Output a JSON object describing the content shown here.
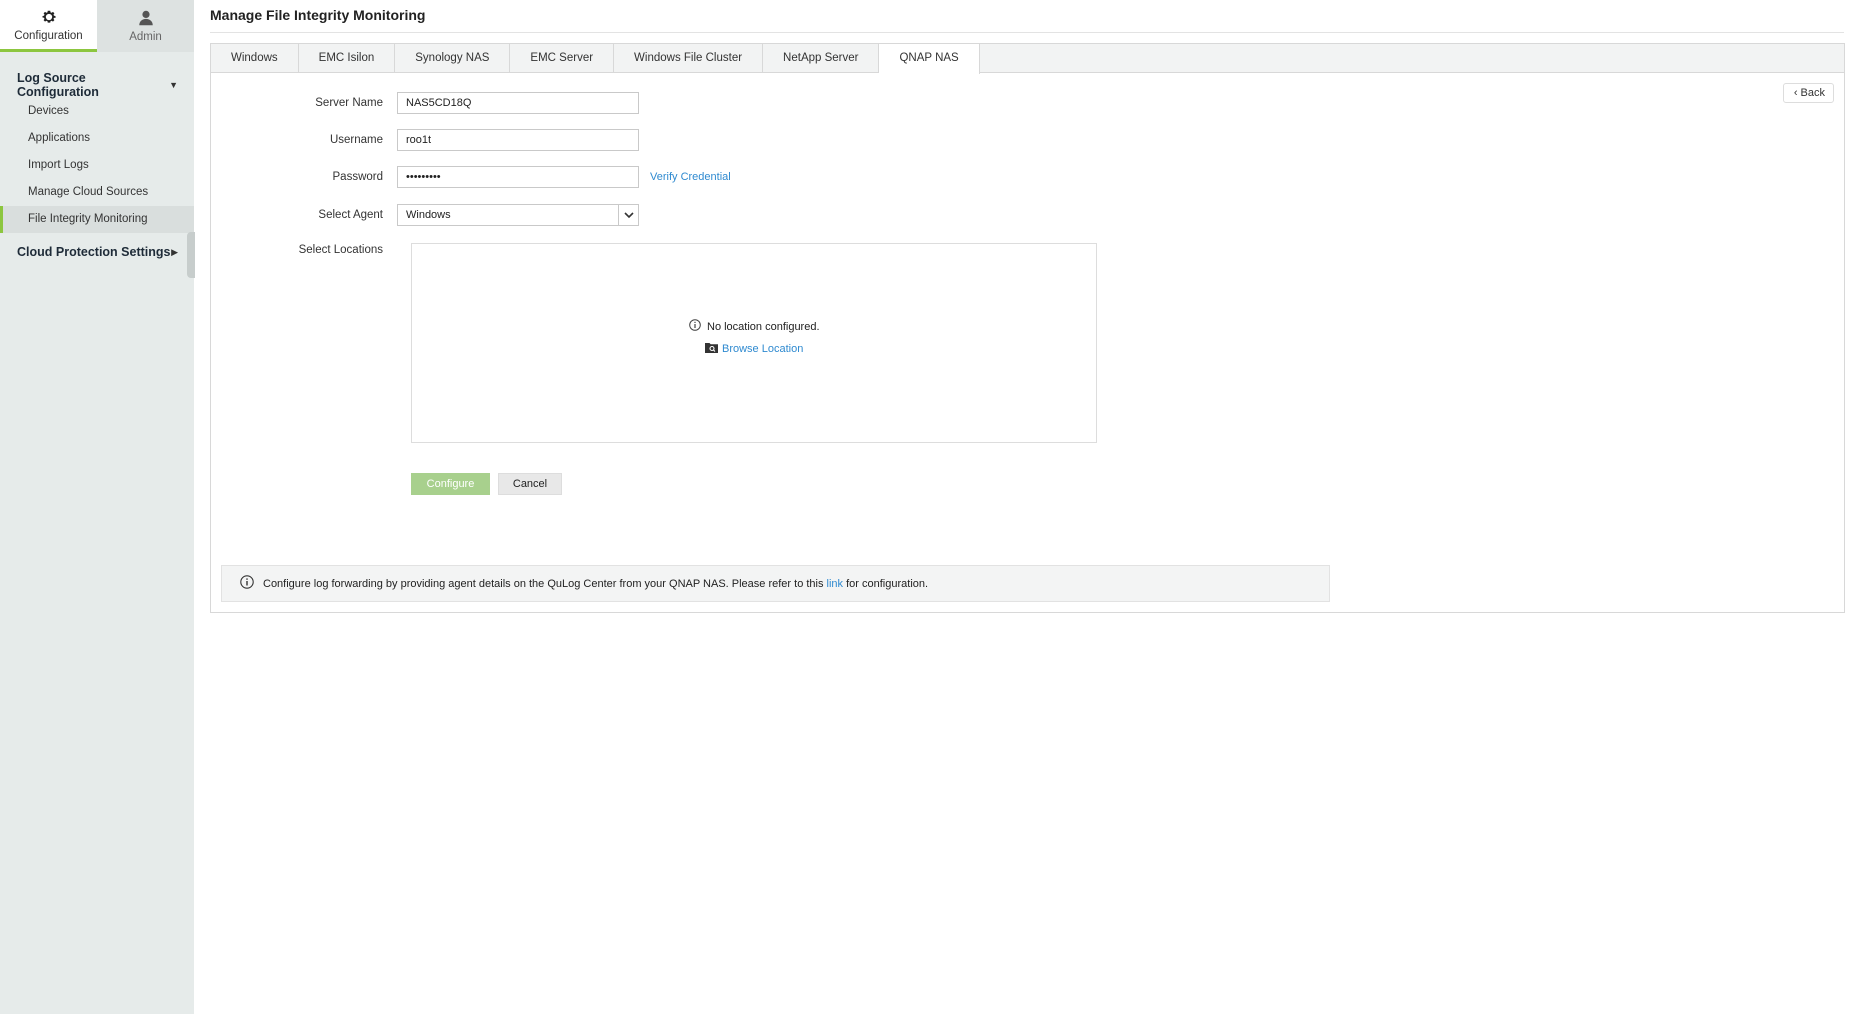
{
  "sidebar": {
    "top_tabs": [
      {
        "label": "Configuration",
        "icon": "gear-icon"
      },
      {
        "label": "Admin",
        "icon": "user-icon"
      }
    ],
    "groups": [
      {
        "label": "Log Source Configuration",
        "items": [
          {
            "label": "Devices"
          },
          {
            "label": "Applications"
          },
          {
            "label": "Import Logs"
          },
          {
            "label": "Manage Cloud Sources"
          },
          {
            "label": "File Integrity Monitoring"
          }
        ]
      },
      {
        "label": "Cloud Protection Settings"
      }
    ]
  },
  "page": {
    "title": "Manage File Integrity Monitoring",
    "back_label": "Back"
  },
  "tabs": [
    "Windows",
    "EMC Isilon",
    "Synology NAS",
    "EMC Server",
    "Windows File Cluster",
    "NetApp Server",
    "QNAP NAS"
  ],
  "form": {
    "server_name_label": "Server Name",
    "server_name_value": "NAS5CD18Q",
    "username_label": "Username",
    "username_value": "roo1t",
    "password_label": "Password",
    "password_value": "•••••••••",
    "verify_label": "Verify Credential",
    "agent_label": "Select Agent",
    "agent_value": "Windows",
    "locations_label": "Select Locations",
    "no_location_text": "No location configured.",
    "browse_label": "Browse Location",
    "configure_label": "Configure",
    "cancel_label": "Cancel"
  },
  "info": {
    "text_before": "Configure log forwarding by providing agent details on the QuLog Center from your QNAP NAS. Please refer to this",
    "link_text": "link",
    "text_after": "for configuration."
  },
  "colors": {
    "accent": "#8cc63f",
    "link": "#2f8ad0",
    "configure_button": "#a8d08d"
  }
}
